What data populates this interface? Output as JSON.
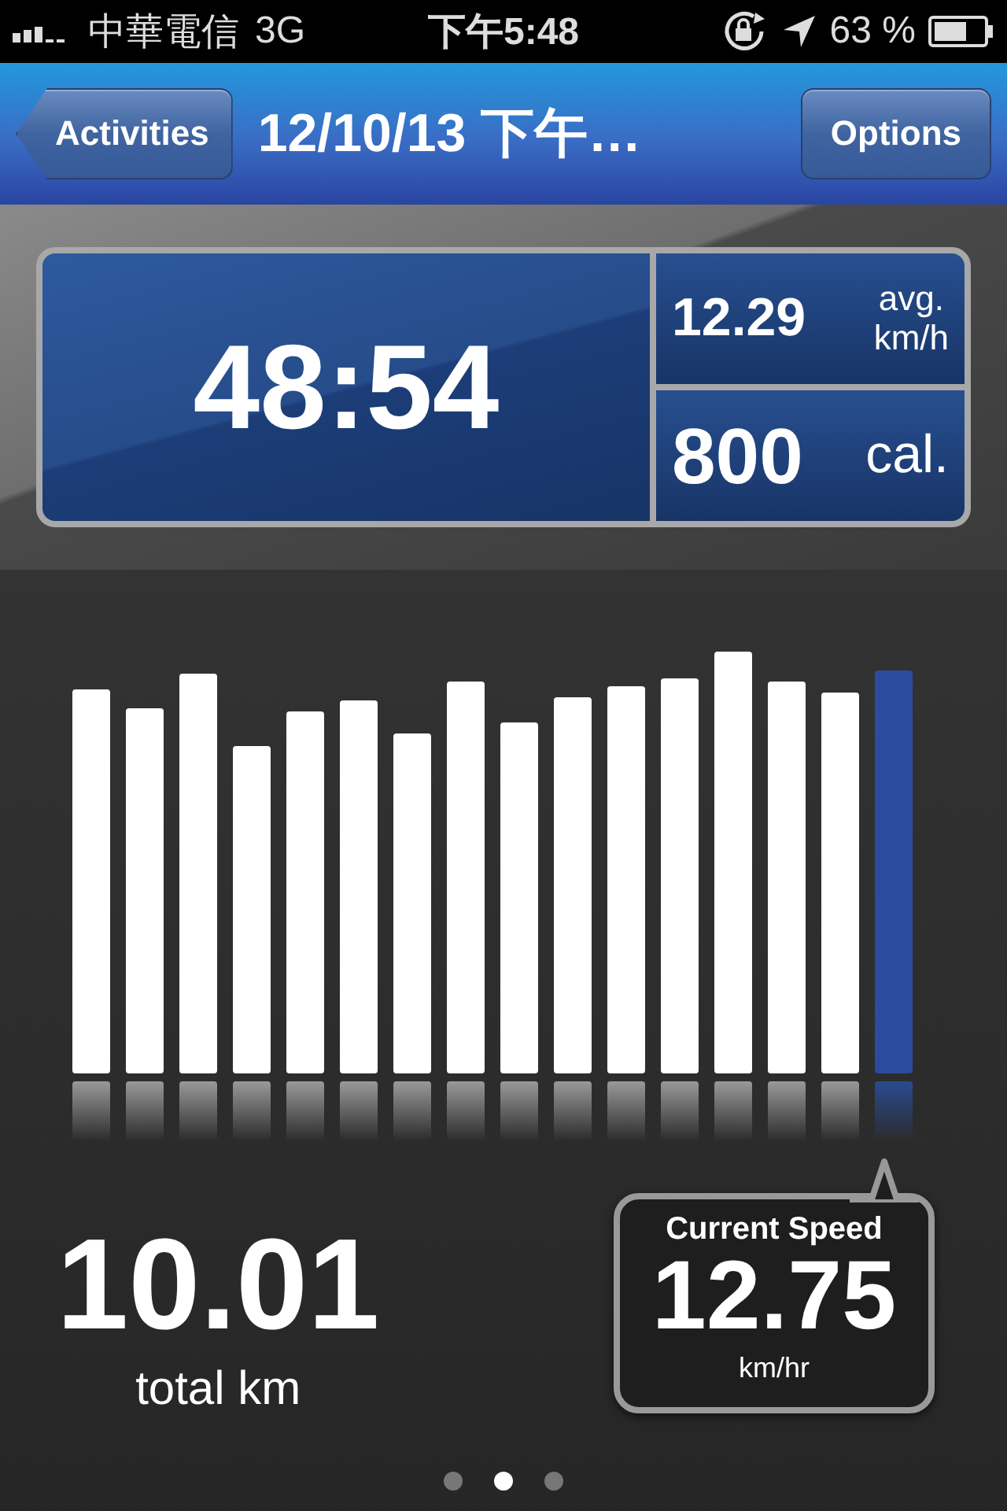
{
  "status_bar": {
    "carrier": "中華電信",
    "network": "3G",
    "time": "下午5:48",
    "battery": "63 %"
  },
  "nav_bar": {
    "back_button": "Activities",
    "title": "12/10/13 下午…",
    "right_button": "Options"
  },
  "summary": {
    "duration": "48:54",
    "avg_speed": "12.29",
    "avg_speed_unit_line_1": "avg.",
    "avg_speed_unit_line_2": "km/h",
    "calories": "800",
    "calories_unit": "cal."
  },
  "bars": [
    {
      "selected": false
    },
    {
      "selected": false
    },
    {
      "selected": false
    },
    {
      "selected": false
    },
    {
      "selected": false
    },
    {
      "selected": false
    },
    {
      "selected": false
    },
    {
      "selected": false
    },
    {
      "selected": false
    },
    {
      "selected": false
    },
    {
      "selected": false
    },
    {
      "selected": false
    },
    {
      "selected": false
    },
    {
      "selected": false
    },
    {
      "selected": false
    },
    {
      "selected": true
    }
  ],
  "total": {
    "value": "10.01",
    "label": "total km"
  },
  "current_speed": {
    "title": "Current Speed",
    "value": "12.75",
    "unit": "km/hr"
  },
  "page_dots": [
    {
      "selected": false
    },
    {
      "selected": true
    },
    {
      "selected": false
    }
  ]
}
